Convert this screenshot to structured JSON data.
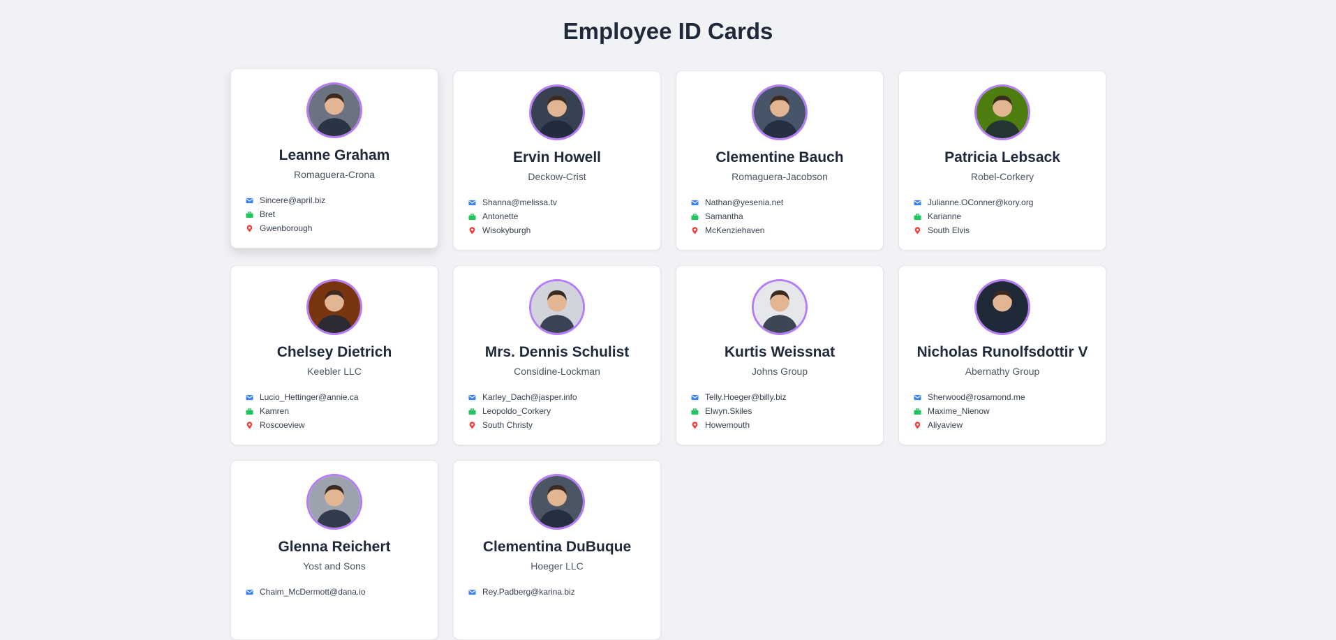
{
  "page": {
    "title": "Employee ID Cards"
  },
  "colors": {
    "email_icon": "#3b82f6",
    "username_icon": "#22c55e",
    "city_icon": "#ef4444",
    "avatar_border": "#b57cf6"
  },
  "icons": {
    "email": "envelope-icon",
    "username": "briefcase-icon",
    "city": "map-pin-icon"
  },
  "employees": [
    {
      "name": "Leanne Graham",
      "company": "Romaguera-Crona",
      "email": "Sincere@april.biz",
      "username": "Bret",
      "city": "Gwenborough",
      "photo_tone": "#6b7280"
    },
    {
      "name": "Ervin Howell",
      "company": "Deckow-Crist",
      "email": "Shanna@melissa.tv",
      "username": "Antonette",
      "city": "Wisokyburgh",
      "photo_tone": "#374151"
    },
    {
      "name": "Clementine Bauch",
      "company": "Romaguera-Jacobson",
      "email": "Nathan@yesenia.net",
      "username": "Samantha",
      "city": "McKenziehaven",
      "photo_tone": "#475569"
    },
    {
      "name": "Patricia Lebsack",
      "company": "Robel-Corkery",
      "email": "Julianne.OConner@kory.org",
      "username": "Karianne",
      "city": "South Elvis",
      "photo_tone": "#4d7c0f"
    },
    {
      "name": "Chelsey Dietrich",
      "company": "Keebler LLC",
      "email": "Lucio_Hettinger@annie.ca",
      "username": "Kamren",
      "city": "Roscoeview",
      "photo_tone": "#78350f"
    },
    {
      "name": "Mrs. Dennis Schulist",
      "company": "Considine-Lockman",
      "email": "Karley_Dach@jasper.info",
      "username": "Leopoldo_Corkery",
      "city": "South Christy",
      "photo_tone": "#d1d5db"
    },
    {
      "name": "Kurtis Weissnat",
      "company": "Johns Group",
      "email": "Telly.Hoeger@billy.biz",
      "username": "Elwyn.Skiles",
      "city": "Howemouth",
      "photo_tone": "#e5e7eb"
    },
    {
      "name": "Nicholas Runolfsdottir V",
      "company": "Abernathy Group",
      "email": "Sherwood@rosamond.me",
      "username": "Maxime_Nienow",
      "city": "Aliyaview",
      "photo_tone": "#1f2937"
    },
    {
      "name": "Glenna Reichert",
      "company": "Yost and Sons",
      "email": "Chaim_McDermott@dana.io",
      "username": "",
      "city": "",
      "photo_tone": "#9ca3af"
    },
    {
      "name": "Clementina DuBuque",
      "company": "Hoeger LLC",
      "email": "Rey.Padberg@karina.biz",
      "username": "",
      "city": "",
      "photo_tone": "#4b5563"
    }
  ]
}
